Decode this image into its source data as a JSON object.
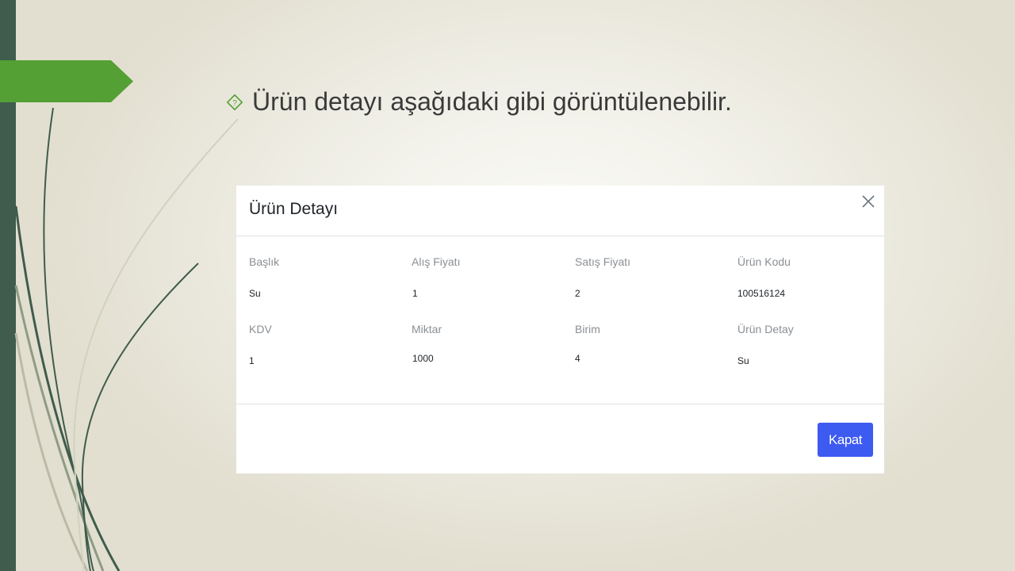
{
  "slide": {
    "bullet_text": "Ürün detayı aşağıdaki gibi görüntülenebilir.",
    "accent_green": "#54a035",
    "sidebar_color": "#3f5c4c"
  },
  "modal": {
    "title": "Ürün Detayı",
    "close_icon": "close-icon",
    "fields": [
      {
        "label": "Başlık",
        "value": "Su"
      },
      {
        "label": "Alış Fiyatı",
        "value": "1"
      },
      {
        "label": "Satış Fiyatı",
        "value": "2"
      },
      {
        "label": "Ürün Kodu",
        "value": "100516124"
      },
      {
        "label": "KDV",
        "value": "1"
      },
      {
        "label": "Miktar",
        "value": "1000"
      },
      {
        "label": "Birim",
        "value": "4"
      },
      {
        "label": "Ürün Detay",
        "value": "Su"
      }
    ],
    "footer": {
      "close_button_label": "Kapat",
      "close_button_color": "#3d5af1"
    }
  }
}
